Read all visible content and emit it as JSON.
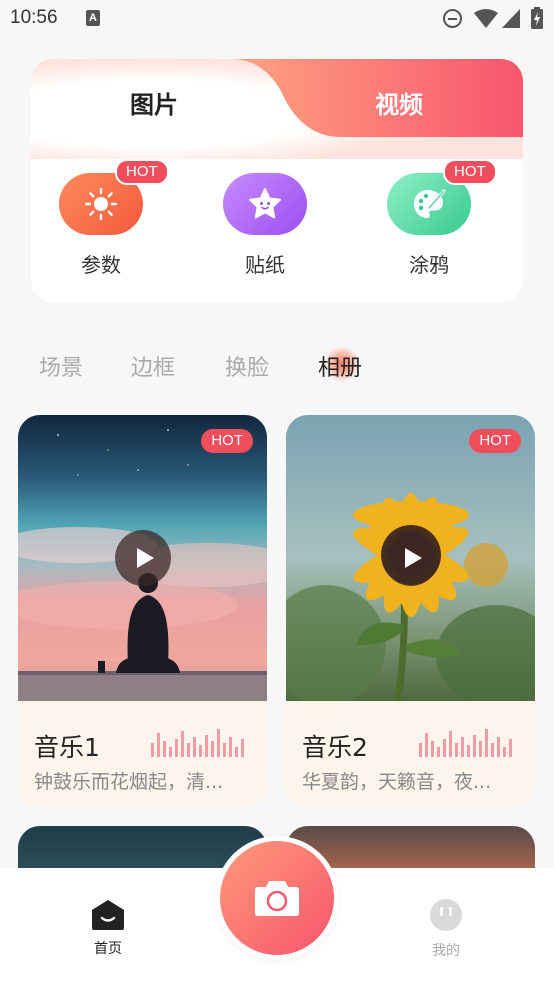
{
  "status_bar": {
    "time": "10:56",
    "notification_icon": "a-letter-icon",
    "icons": [
      "do-not-disturb-icon",
      "wifi-icon",
      "signal-icon",
      "battery-icon"
    ]
  },
  "top_tabs": {
    "photo": "图片",
    "video": "视频",
    "active": "photo"
  },
  "tools": [
    {
      "label": "参数",
      "icon": "sun-icon",
      "hot": true,
      "hot_label": "HOT"
    },
    {
      "label": "贴纸",
      "icon": "star-face-icon",
      "hot": false
    },
    {
      "label": "涂鸦",
      "icon": "palette-icon",
      "hot": true,
      "hot_label": "HOT"
    }
  ],
  "categories": {
    "items": [
      "场景",
      "边框",
      "换脸",
      "相册"
    ],
    "active_index": 3
  },
  "media": [
    {
      "title": "音乐1",
      "desc": "钟鼓乐而花烟起，清...",
      "hot_label": "HOT"
    },
    {
      "title": "音乐2",
      "desc": "华夏韵，天籁音，夜...",
      "hot_label": "HOT"
    }
  ],
  "bottom_nav": {
    "home": "首页",
    "mine": "我的",
    "active": "home"
  },
  "colors": {
    "accent_start": "#ff9a7a",
    "accent_end": "#f7566d",
    "hot_badge": "#f04e5c"
  }
}
